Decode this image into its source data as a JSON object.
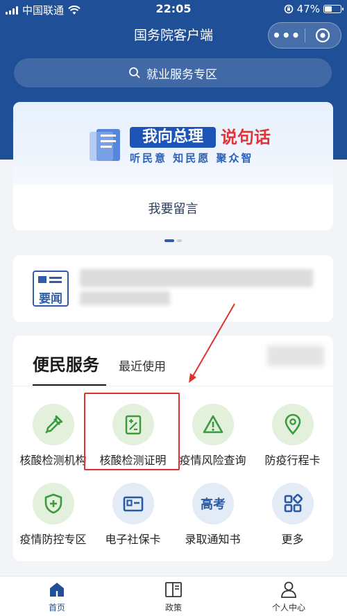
{
  "status": {
    "carrier": "中国联通",
    "time": "22:05",
    "battery": "47%",
    "battery_level": 0.47
  },
  "nav": {
    "title": "国务院客户端"
  },
  "search": {
    "placeholder": "就业服务专区"
  },
  "banner": {
    "headline_part1": "我向总理",
    "headline_part2": "说句话",
    "subline": "听民意 知民愿 聚众智",
    "action": "我要留言"
  },
  "news": {
    "icon_label": "要闻"
  },
  "services": {
    "tab_active": "便民服务",
    "tab_recent": "最近使用",
    "items": [
      {
        "label": "核酸检测机构",
        "icon": "dropper-icon"
      },
      {
        "label": "核酸检测证明",
        "icon": "certificate-icon"
      },
      {
        "label": "疫情风险查询",
        "icon": "warning-icon"
      },
      {
        "label": "防疫行程卡",
        "icon": "location-pin-icon"
      },
      {
        "label": "疫情防控专区",
        "icon": "shield-plus-icon"
      },
      {
        "label": "电子社保卡",
        "icon": "id-card-icon",
        "glyph": ""
      },
      {
        "label": "录取通知书",
        "icon": "gaokao-icon",
        "glyph": "高考"
      },
      {
        "label": "更多",
        "icon": "grid-more-icon"
      }
    ]
  },
  "tabbar": {
    "items": [
      {
        "label": "首页",
        "active": true
      },
      {
        "label": "政策",
        "active": false
      },
      {
        "label": "个人中心",
        "active": false
      }
    ]
  },
  "colors": {
    "header": "#1f4f96",
    "accent_blue": "#1c54b8",
    "accent_red": "#e2333b",
    "highlight_red": "#e0312c",
    "green_icon": "#3a9a3e",
    "blue_icon": "#2b5aa3"
  }
}
